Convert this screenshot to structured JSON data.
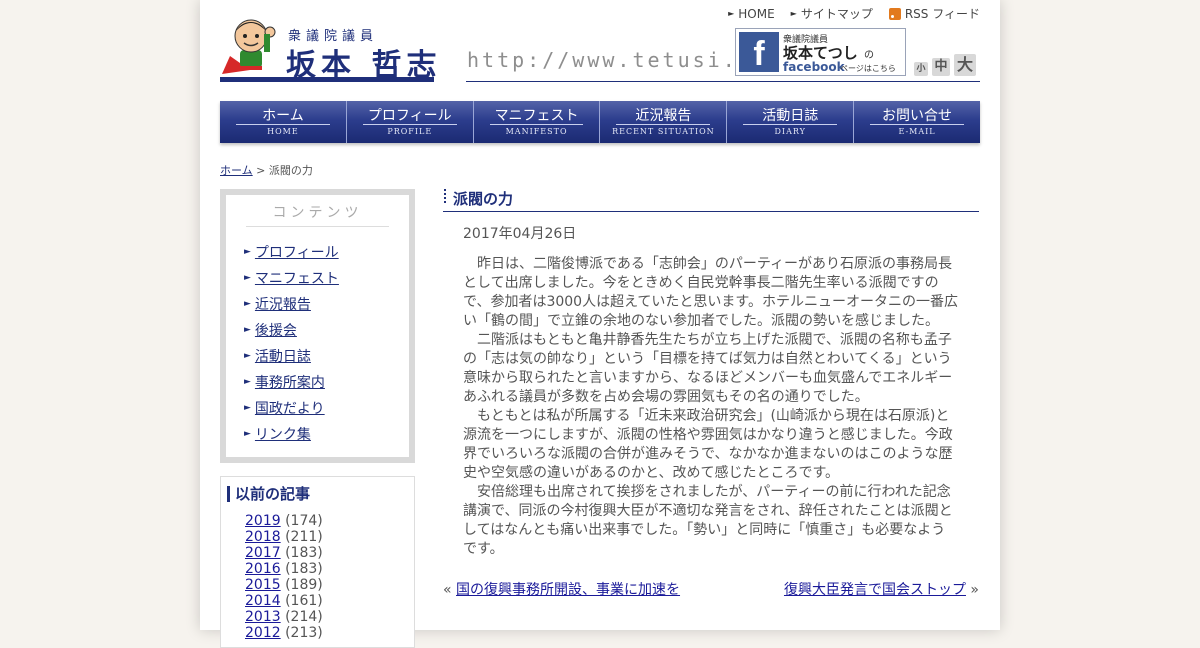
{
  "header": {
    "subtitle": "衆議院議員",
    "name": "坂本 哲志",
    "url": "http://www.tetusi.com",
    "links": [
      {
        "label": "HOME"
      },
      {
        "label": "サイトマップ"
      },
      {
        "label": "RSS フィード"
      }
    ],
    "facebook": {
      "sub": "衆議院議員",
      "name": "坂本てつし",
      "no": "の",
      "word": "facebook",
      "here": "ページはこちら"
    },
    "font_sizes": {
      "small": "小",
      "medium": "中",
      "large": "大"
    }
  },
  "nav": [
    {
      "jp": "ホーム",
      "en": "HOME"
    },
    {
      "jp": "プロフィール",
      "en": "PROFILE"
    },
    {
      "jp": "マニフェスト",
      "en": "MANIFESTO"
    },
    {
      "jp": "近況報告",
      "en": "RECENT SITUATION"
    },
    {
      "jp": "活動日誌",
      "en": "DIARY"
    },
    {
      "jp": "お問い合せ",
      "en": "E-MAIL"
    }
  ],
  "breadcrumb": {
    "home": "ホーム",
    "sep": " > ",
    "current": "派閥の力"
  },
  "sidebar": {
    "contents_title": "コンテンツ",
    "contents": [
      "プロフィール",
      "マニフェスト",
      "近況報告",
      "後援会",
      "活動日誌",
      "事務所案内",
      "国政だより",
      "リンク集"
    ],
    "archive_title": "以前の記事",
    "archive": [
      {
        "year": "2019",
        "count": "(174)"
      },
      {
        "year": "2018",
        "count": "(211)"
      },
      {
        "year": "2017",
        "count": "(183)"
      },
      {
        "year": "2016",
        "count": "(183)"
      },
      {
        "year": "2015",
        "count": "(189)"
      },
      {
        "year": "2014",
        "count": "(161)"
      },
      {
        "year": "2013",
        "count": "(214)"
      },
      {
        "year": "2012",
        "count": "(213)"
      }
    ]
  },
  "article": {
    "title": "派閥の力",
    "date": "2017年04月26日",
    "paragraphs": [
      "昨日は、二階俊博派である「志帥会」のパーティーがあり石原派の事務局長として出席しました。今をときめく自民党幹事長二階先生率いる派閥ですので、参加者は3000人は超えていたと思います。ホテルニューオータニの一番広い「鶴の間」で立錐の余地のない参加者でした。派閥の勢いを感じました。",
      "二階派はもともと亀井静香先生たちが立ち上げた派閥で、派閥の名称も孟子の「志は気の帥なり」という「目標を持てば気力は自然とわいてくる」という意味から取られたと言いますから、なるほどメンバーも血気盛んでエネルギーあふれる議員が多数を占め会場の雰囲気もその名の通りでした。",
      "もともとは私が所属する「近未来政治研究会」(山崎派から現在は石原派)と源流を一つにしますが、派閥の性格や雰囲気はかなり違うと感じました。今政界でいろいろな派閥の合併が進みそうで、なかなか進まないのはこのような歴史や空気感の違いがあるのかと、改めて感じたところです。",
      "安倍総理も出席されて挨拶をされましたが、パーティーの前に行われた記念講演で、同派の今村復興大臣が不適切な発言をされ、辞任されたことは派閥としてはなんとも痛い出来事でした。「勢い」と同時に「慎重さ」も必要なようです。"
    ],
    "prev_label": "国の復興事務所開設、事業に加速を",
    "next_label": "復興大臣発言で国会ストップ",
    "prev_mark": "«",
    "next_mark": "»"
  },
  "colors": {
    "brand": "#1f2f7a",
    "nav_top": "#5463a8",
    "nav_bottom": "#1b2a72",
    "link": "#1a1a99"
  }
}
